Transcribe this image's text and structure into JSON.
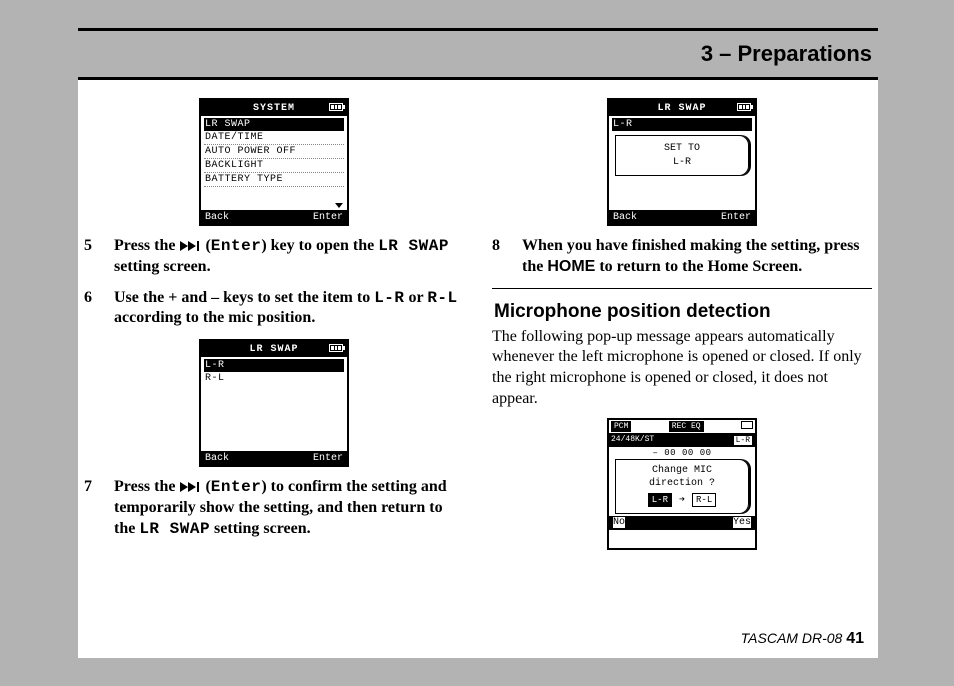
{
  "chapter_title": "3 – Preparations",
  "lcd_system": {
    "title": "SYSTEM",
    "items": [
      "LR SWAP",
      "DATE/TIME",
      "AUTO POWER OFF",
      "BACKLIGHT",
      "BATTERY TYPE"
    ],
    "foot_left": "Back",
    "foot_right": "Enter"
  },
  "step5": {
    "num": "5",
    "t1": "Press the ",
    "enter": "Enter",
    "t2": ") key to open the ",
    "mono1": "LR SWAP",
    "t3": " setting screen."
  },
  "step6": {
    "num": "6",
    "t1": "Use the + and – keys to set the item to ",
    "mono1": "L-R",
    "t2": " or ",
    "mono2": "R-L",
    "t3": " according to the mic position."
  },
  "lcd_lrswap": {
    "title": "LR SWAP",
    "items": [
      "L-R",
      "R-L"
    ],
    "foot_left": "Back",
    "foot_right": "Enter"
  },
  "step7": {
    "num": "7",
    "t1": "Press the ",
    "enter": "Enter",
    "t2": ") to confirm the setting and temporarily show the setting, and then return to the ",
    "mono1": "LR SWAP",
    "t3": " setting screen."
  },
  "lcd_setto": {
    "title": "LR SWAP",
    "row": "L-R",
    "popup_l1": "SET TO",
    "popup_l2": "L-R",
    "foot_left": "Back",
    "foot_right": "Enter"
  },
  "step8": {
    "num": "8",
    "t1": "When you have finished making the setting, press the ",
    "home": "HOME",
    "t2": " to return to the Home Screen."
  },
  "subhead": "Microphone position detection",
  "para": "The following pop-up message appears automatically whenever the left microphone is opened or closed. If only the right microphone is opened or closed, it does not appear.",
  "lcd_home": {
    "pcm": "PCM",
    "receq": "REC EQ",
    "rate": "24/48K/ST",
    "lr": "L-R",
    "time": "– 00 00 00",
    "popup_l1": "Change MIC",
    "popup_l2": "direction ?",
    "chip_from": "L-R",
    "chip_to": "R-L",
    "no": "No",
    "yes": "Yes"
  },
  "footer_brand": "TASCAM  DR-08 ",
  "footer_page": "41"
}
